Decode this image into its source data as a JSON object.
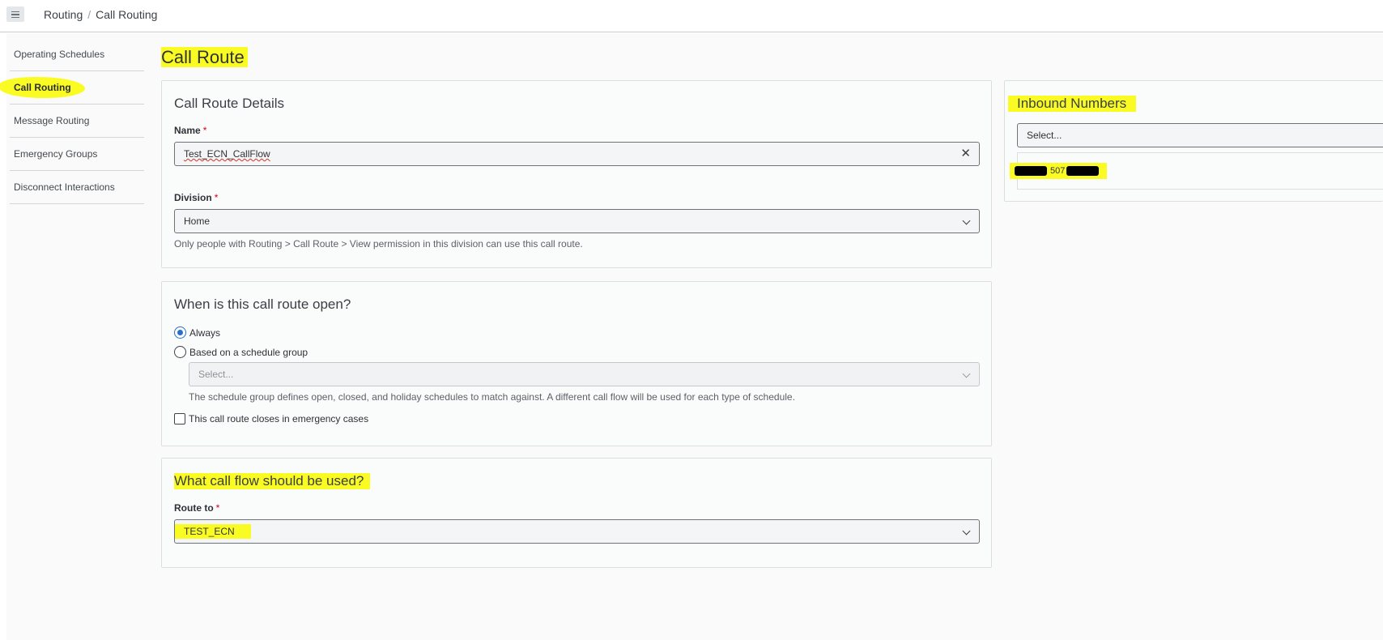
{
  "header": {
    "menu_icon": "hamburger-menu-icon",
    "breadcrumb": [
      "Routing",
      "Call Routing"
    ],
    "separator": "/"
  },
  "sidebar": {
    "items": [
      {
        "label": "Operating Schedules",
        "active": false
      },
      {
        "label": "Call Routing",
        "active": true
      },
      {
        "label": "Message Routing",
        "active": false
      },
      {
        "label": "Emergency Groups",
        "active": false
      },
      {
        "label": "Disconnect Interactions",
        "active": false
      }
    ]
  },
  "page": {
    "title": "Call Route"
  },
  "details": {
    "heading": "Call Route Details",
    "name_label": "Name",
    "name_value": "Test_ECN_CallFlow",
    "clear_icon": "close-icon",
    "division_label": "Division",
    "division_value": "Home",
    "division_help": "Only people with Routing > Call Route > View permission in this division can use this call route.",
    "required_mark": "*"
  },
  "schedule": {
    "heading": "When is this call route open?",
    "always_label": "Always",
    "schedule_group_label": "Based on a schedule group",
    "schedule_placeholder": "Select...",
    "schedule_help": "The schedule group defines open, closed, and holiday schedules to match against. A different call flow will be used for each type of schedule.",
    "emergency_label": "This call route closes in emergency cases",
    "selected": "Always"
  },
  "callflow": {
    "heading": "What call flow should be used?",
    "route_label": "Route to",
    "route_value": "TEST_ECN"
  },
  "inbound": {
    "heading": "Inbound Numbers",
    "select_placeholder": "Select...",
    "number_visible": "507"
  },
  "colors": {
    "highlight": "#fbfb24",
    "accent": "#2a6fcb",
    "required": "#d0021b"
  }
}
